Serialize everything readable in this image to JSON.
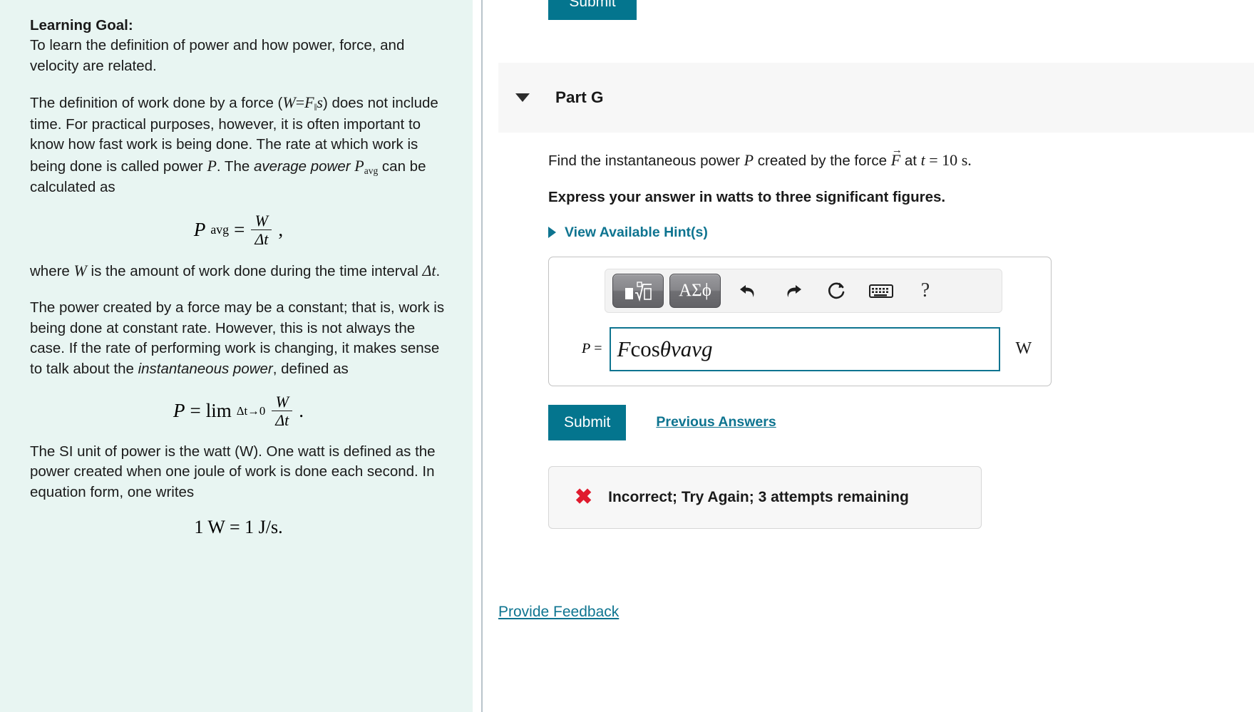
{
  "left_panel": {
    "goal_title": "Learning Goal:",
    "goal_text": "To learn the definition of power and how power, force, and velocity are related.",
    "para1_a": "The definition of work done by a force (",
    "para1_W": "W",
    "para1_eq": "=",
    "para1_F": "F",
    "para1_Fsub": "‖",
    "para1_s": "s",
    "para1_b": ") does not include time. For practical purposes, however, it is often important to know how fast work is being done. The rate at which work is being done is called power ",
    "para1_P": "P",
    "para1_c": ". The ",
    "para1_avgpower": "average power ",
    "para1_Pavg_base": "P",
    "para1_Pavg_sub": "avg",
    "para1_d": " can be calculated as",
    "eq1_P": "P",
    "eq1_Psub": "avg",
    "eq1_equals": "=",
    "eq1_num": "W",
    "eq1_den": "Δt",
    "eq1_tail": ",",
    "para2_a": "where ",
    "para2_W": "W",
    "para2_b": " is the amount of work done during the time interval ",
    "para2_dt": "Δt",
    "para2_c": ".",
    "para3_a": "The power created by a force may be a constant; that is, work is being done at constant rate. However, this is not always the case. If the rate of performing work is changing, it makes sense to talk about the ",
    "para3_italic": "instantaneous power",
    "para3_b": ", defined as",
    "eq2_P": "P",
    "eq2_equals": "=",
    "eq2_lim": "lim",
    "eq2_limsub": "Δt→0",
    "eq2_num": "W",
    "eq2_den": "Δt",
    "eq2_tail": ".",
    "para4": "The SI unit of power is the watt (W). One watt is defined as the power created when one joule of work is done each second. In equation form, one writes",
    "eq3": "1 W = 1 J/s."
  },
  "right_panel": {
    "cut_submit_label": "Submit",
    "part_title": "Part G",
    "question_a": "Find the instantaneous power ",
    "question_P": "P",
    "question_b": " created by the force ",
    "question_F": "F",
    "question_c": " at ",
    "question_t": "t",
    "question_eq": " = 10",
    "question_unit": " s.",
    "instruction": "Express your answer in watts to three significant figures.",
    "hints_label": "View Available Hint(s)",
    "toolbar": {
      "template_button": "template-icon",
      "greek_button": "ΑΣϕ",
      "undo": "undo-icon",
      "redo": "redo-icon",
      "reset": "reset-icon",
      "keyboard": "keyboard-icon",
      "help": "?"
    },
    "answer": {
      "prefix_var": "P",
      "prefix_eq": "=",
      "value_F": "F",
      "value_cos": " cos ",
      "value_rest": "θvavg",
      "unit": "W"
    },
    "submit_label": "Submit",
    "previous_answers_label": "Previous Answers",
    "feedback": {
      "icon": "✖",
      "message": "Incorrect; Try Again; 3 attempts remaining"
    },
    "provide_feedback_label": "Provide Feedback"
  },
  "colors": {
    "left_bg": "#e8f5f2",
    "accent_teal": "#04758e",
    "link_teal": "#0e7490",
    "error_red": "#e01b2e",
    "panel_gray": "#f7f7f7"
  }
}
